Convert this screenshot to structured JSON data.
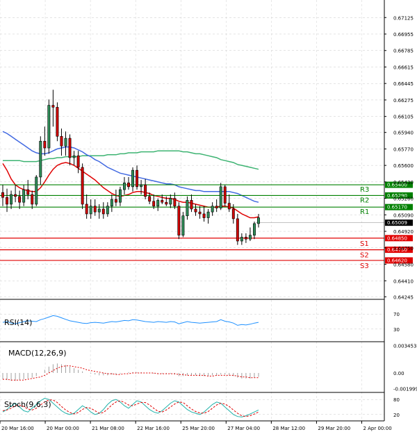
{
  "chart_data": {
    "type": "candlestick",
    "price_axis_labels": [
      "0.67125",
      "0.66955",
      "0.66785",
      "0.66615",
      "0.66445",
      "0.66275",
      "0.66105",
      "0.65940",
      "0.65770",
      "0.65600",
      "0.65430",
      "0.65260",
      "0.65090",
      "0.64920",
      "0.64750",
      "0.64580",
      "0.64410",
      "0.64245"
    ],
    "ylim": [
      0.6424,
      0.6722
    ],
    "x_labels": [
      "20 Mar 16:00",
      "20 Mar 00:00",
      "21 Mar 08:00",
      "22 Mar 16:00",
      "25 Mar 20:00",
      "27 Mar 04:00",
      "28 Mar 12:00",
      "29 Mar 20:00",
      "2 Apr 00:00"
    ],
    "candles": [
      [
        0.6532,
        0.654,
        0.6518,
        0.6527
      ],
      [
        0.6527,
        0.6536,
        0.6512,
        0.652
      ],
      [
        0.652,
        0.6534,
        0.6515,
        0.653
      ],
      [
        0.653,
        0.654,
        0.6522,
        0.6528
      ],
      [
        0.6528,
        0.6534,
        0.6515,
        0.6522
      ],
      [
        0.6522,
        0.654,
        0.6518,
        0.6535
      ],
      [
        0.6535,
        0.6545,
        0.6525,
        0.653
      ],
      [
        0.653,
        0.6534,
        0.6515,
        0.652
      ],
      [
        0.652,
        0.655,
        0.6518,
        0.6548
      ],
      [
        0.6548,
        0.659,
        0.654,
        0.6585
      ],
      [
        0.6585,
        0.66,
        0.657,
        0.6578
      ],
      [
        0.6578,
        0.6628,
        0.6572,
        0.6622
      ],
      [
        0.6622,
        0.6638,
        0.66,
        0.662
      ],
      [
        0.662,
        0.6625,
        0.6585,
        0.659
      ],
      [
        0.659,
        0.6598,
        0.657,
        0.658
      ],
      [
        0.658,
        0.6595,
        0.657,
        0.6588
      ],
      [
        0.6588,
        0.6592,
        0.656,
        0.6568
      ],
      [
        0.6568,
        0.6575,
        0.656,
        0.657
      ],
      [
        0.657,
        0.6575,
        0.6552,
        0.6558
      ],
      [
        0.6558,
        0.6562,
        0.6515,
        0.652
      ],
      [
        0.652,
        0.653,
        0.6505,
        0.651
      ],
      [
        0.651,
        0.6525,
        0.6505,
        0.6518
      ],
      [
        0.6518,
        0.6525,
        0.6508,
        0.6512
      ],
      [
        0.6512,
        0.652,
        0.6505,
        0.6515
      ],
      [
        0.6515,
        0.6522,
        0.6505,
        0.651
      ],
      [
        0.651,
        0.6522,
        0.6507,
        0.6518
      ],
      [
        0.6518,
        0.653,
        0.6512,
        0.6525
      ],
      [
        0.6525,
        0.6535,
        0.6518,
        0.6522
      ],
      [
        0.6522,
        0.6538,
        0.6518,
        0.6535
      ],
      [
        0.6535,
        0.6548,
        0.653,
        0.6542
      ],
      [
        0.6542,
        0.6548,
        0.6535,
        0.6538
      ],
      [
        0.6538,
        0.6558,
        0.6533,
        0.6555
      ],
      [
        0.6555,
        0.656,
        0.6535,
        0.6538
      ],
      [
        0.6538,
        0.6545,
        0.653,
        0.654
      ],
      [
        0.654,
        0.6546,
        0.6525,
        0.6528
      ],
      [
        0.6528,
        0.6532,
        0.652,
        0.6523
      ],
      [
        0.6523,
        0.653,
        0.6515,
        0.6518
      ],
      [
        0.6518,
        0.6526,
        0.6513,
        0.6524
      ],
      [
        0.6524,
        0.653,
        0.652,
        0.6522
      ],
      [
        0.6522,
        0.6528,
        0.6518,
        0.652
      ],
      [
        0.652,
        0.653,
        0.6516,
        0.6526
      ],
      [
        0.6526,
        0.6532,
        0.6515,
        0.6518
      ],
      [
        0.6518,
        0.6522,
        0.6484,
        0.6488
      ],
      [
        0.6488,
        0.6512,
        0.6486,
        0.6508
      ],
      [
        0.6508,
        0.6528,
        0.6504,
        0.6524
      ],
      [
        0.6524,
        0.653,
        0.6512,
        0.6515
      ],
      [
        0.6515,
        0.652,
        0.6508,
        0.6512
      ],
      [
        0.6512,
        0.6518,
        0.6505,
        0.651
      ],
      [
        0.651,
        0.6518,
        0.6502,
        0.6506
      ],
      [
        0.6506,
        0.6515,
        0.65,
        0.6512
      ],
      [
        0.6512,
        0.6522,
        0.6508,
        0.6518
      ],
      [
        0.6518,
        0.6525,
        0.6512,
        0.6516
      ],
      [
        0.6516,
        0.6542,
        0.6514,
        0.6538
      ],
      [
        0.6538,
        0.654,
        0.6518,
        0.6521
      ],
      [
        0.6521,
        0.653,
        0.6512,
        0.6515
      ],
      [
        0.6515,
        0.652,
        0.65,
        0.6505
      ],
      [
        0.6505,
        0.651,
        0.6478,
        0.6482
      ],
      [
        0.6482,
        0.649,
        0.6478,
        0.6486
      ],
      [
        0.6486,
        0.649,
        0.648,
        0.6484
      ],
      [
        0.6484,
        0.6496,
        0.6482,
        0.6488
      ],
      [
        0.6488,
        0.6502,
        0.6484,
        0.65
      ],
      [
        0.65,
        0.651,
        0.6496,
        0.6506
      ]
    ],
    "ma_red": [
      0.6562,
      0.6555,
      0.6546,
      0.654,
      0.6537,
      0.6535,
      0.6534,
      0.6533,
      0.6533,
      0.6537,
      0.6543,
      0.655,
      0.6556,
      0.656,
      0.6562,
      0.6563,
      0.6562,
      0.656,
      0.6557,
      0.6554,
      0.6551,
      0.6548,
      0.6545,
      0.6541,
      0.6537,
      0.6534,
      0.6531,
      0.6529,
      0.6528,
      0.6529,
      0.653,
      0.6532,
      0.6533,
      0.6533,
      0.6532,
      0.6531,
      0.6529,
      0.6528,
      0.6527,
      0.6526,
      0.6526,
      0.6525,
      0.6523,
      0.6522,
      0.6522,
      0.6521,
      0.652,
      0.6519,
      0.6518,
      0.6517,
      0.6517,
      0.6517,
      0.6518,
      0.6518,
      0.6517,
      0.6516,
      0.6513,
      0.651,
      0.6508,
      0.6506,
      0.6506,
      0.6507
    ],
    "ma_blue": [
      0.6595,
      0.6593,
      0.659,
      0.6587,
      0.6584,
      0.6581,
      0.6578,
      0.6575,
      0.6573,
      0.6572,
      0.6572,
      0.6573,
      0.6575,
      0.6577,
      0.6578,
      0.6579,
      0.6579,
      0.6578,
      0.6576,
      0.6574,
      0.6571,
      0.6569,
      0.6566,
      0.6564,
      0.6561,
      0.6558,
      0.6556,
      0.6554,
      0.6552,
      0.6551,
      0.655,
      0.6549,
      0.6548,
      0.6547,
      0.6546,
      0.6545,
      0.6544,
      0.6543,
      0.6542,
      0.6541,
      0.6541,
      0.654,
      0.6538,
      0.6537,
      0.6536,
      0.6535,
      0.6534,
      0.6534,
      0.6533,
      0.6533,
      0.6533,
      0.6533,
      0.6533,
      0.6533,
      0.6533,
      0.6532,
      0.6531,
      0.6529,
      0.6527,
      0.6525,
      0.6523,
      0.6522
    ],
    "ma_green": [
      0.6565,
      0.6565,
      0.6565,
      0.6565,
      0.6565,
      0.6564,
      0.6564,
      0.6564,
      0.6564,
      0.6565,
      0.6566,
      0.6567,
      0.6567,
      0.6568,
      0.6568,
      0.6569,
      0.6569,
      0.6569,
      0.6569,
      0.657,
      0.657,
      0.657,
      0.657,
      0.657,
      0.657,
      0.6571,
      0.6571,
      0.6571,
      0.6572,
      0.6572,
      0.6573,
      0.6573,
      0.6573,
      0.6574,
      0.6574,
      0.6574,
      0.6574,
      0.6575,
      0.6575,
      0.6575,
      0.6575,
      0.6575,
      0.6575,
      0.6574,
      0.6574,
      0.6573,
      0.6572,
      0.6572,
      0.6571,
      0.657,
      0.6569,
      0.6568,
      0.6566,
      0.6565,
      0.6564,
      0.6563,
      0.6561,
      0.656,
      0.6559,
      0.6558,
      0.6557,
      0.6556
    ],
    "levels": [
      {
        "name": "R3",
        "value": "0.65400",
        "color": "#008000"
      },
      {
        "name": "R2",
        "value": "0.65290",
        "color": "#008000"
      },
      {
        "name": "R1",
        "value": "0.65170",
        "color": "#008000"
      },
      {
        "name": "S1",
        "value": "0.64850",
        "color": "#e00000"
      },
      {
        "name": "S2",
        "value": "0.64730",
        "color": "#e00000"
      },
      {
        "name": "S3",
        "value": "0.64620",
        "color": "#e00000"
      }
    ],
    "current_price": "0.65009",
    "rsi": {
      "label": "RSI(14)",
      "axis": [
        "70",
        "30"
      ],
      "ylim": [
        0,
        100
      ],
      "values": [
        48,
        50,
        46,
        44,
        47,
        50,
        52,
        51,
        50,
        55,
        58,
        62,
        66,
        64,
        60,
        56,
        52,
        50,
        48,
        46,
        45,
        47,
        48,
        47,
        46,
        48,
        50,
        49,
        51,
        53,
        52,
        55,
        54,
        52,
        50,
        49,
        48,
        50,
        49,
        48,
        50,
        49,
        44,
        47,
        50,
        48,
        47,
        46,
        47,
        48,
        49,
        50,
        55,
        51,
        49,
        46,
        40,
        42,
        41,
        43,
        46,
        48
      ]
    },
    "macd": {
      "label": "MACD(12,26,9)",
      "axis": [
        "0.003453",
        "0.00",
        "-0.001999"
      ],
      "ylim": [
        -0.0022,
        0.0036
      ],
      "hist": [
        -0.0008,
        -0.0009,
        -0.001,
        -0.001,
        -0.0009,
        -0.0008,
        -0.0007,
        -0.0006,
        -0.0004,
        0.0,
        0.0004,
        0.0008,
        0.0011,
        0.0012,
        0.0011,
        0.001,
        0.0008,
        0.0006,
        0.0004,
        0.0002,
        0.0,
        -0.0001,
        -0.0002,
        -0.0003,
        -0.0003,
        -0.0003,
        -0.0002,
        -0.0002,
        -0.0001,
        0.0,
        0.0001,
        0.0001,
        0.0001,
        0.0001,
        0.0,
        0.0,
        -0.0001,
        -0.0001,
        -0.0001,
        -0.0001,
        -0.0001,
        -0.0002,
        -0.0004,
        -0.0004,
        -0.0003,
        -0.0003,
        -0.0003,
        -0.0004,
        -0.0004,
        -0.0004,
        -0.0003,
        -0.0003,
        -0.0002,
        -0.0002,
        -0.0003,
        -0.0004,
        -0.0006,
        -0.0007,
        -0.0007,
        -0.0007,
        -0.0006,
        -0.0005
      ],
      "signal": [
        -0.0008,
        -0.0008,
        -0.0009,
        -0.0009,
        -0.0009,
        -0.0009,
        -0.0008,
        -0.0007,
        -0.0006,
        -0.0005,
        -0.0003,
        0.0,
        0.0003,
        0.0006,
        0.0008,
        0.0009,
        0.0009,
        0.0008,
        0.0007,
        0.0006,
        0.0004,
        0.0003,
        0.0002,
        0.0001,
        0.0,
        -0.0001,
        -0.0001,
        -0.0002,
        -0.0002,
        -0.0001,
        -0.0001,
        0.0,
        0.0,
        0.0,
        0.0,
        0.0,
        0.0,
        -0.0001,
        -0.0001,
        -0.0001,
        -0.0001,
        -0.0001,
        -0.0002,
        -0.0002,
        -0.0003,
        -0.0003,
        -0.0003,
        -0.0003,
        -0.0003,
        -0.0004,
        -0.0004,
        -0.0003,
        -0.0003,
        -0.0003,
        -0.0003,
        -0.0003,
        -0.0004,
        -0.0005,
        -0.0005,
        -0.0006,
        -0.0006,
        -0.0006
      ]
    },
    "stoch": {
      "label": "Stoch(9,6,3)",
      "axis": [
        "80",
        "20"
      ],
      "ylim": [
        0,
        100
      ],
      "k": [
        30,
        40,
        55,
        65,
        50,
        35,
        30,
        45,
        60,
        75,
        85,
        80,
        65,
        50,
        35,
        25,
        20,
        25,
        40,
        55,
        45,
        30,
        20,
        25,
        40,
        60,
        75,
        80,
        70,
        55,
        45,
        60,
        75,
        70,
        55,
        40,
        30,
        25,
        35,
        50,
        65,
        75,
        70,
        55,
        40,
        30,
        25,
        20,
        30,
        45,
        60,
        70,
        65,
        50,
        35,
        20,
        12,
        10,
        15,
        22,
        30,
        38
      ],
      "d": [
        35,
        38,
        45,
        55,
        58,
        52,
        42,
        38,
        45,
        58,
        70,
        78,
        78,
        68,
        52,
        38,
        28,
        22,
        28,
        40,
        48,
        45,
        35,
        25,
        28,
        42,
        58,
        70,
        75,
        68,
        58,
        55,
        62,
        68,
        68,
        58,
        45,
        33,
        30,
        38,
        50,
        62,
        70,
        68,
        55,
        42,
        32,
        26,
        25,
        32,
        45,
        58,
        65,
        62,
        52,
        38,
        25,
        15,
        12,
        15,
        22,
        30
      ]
    }
  }
}
